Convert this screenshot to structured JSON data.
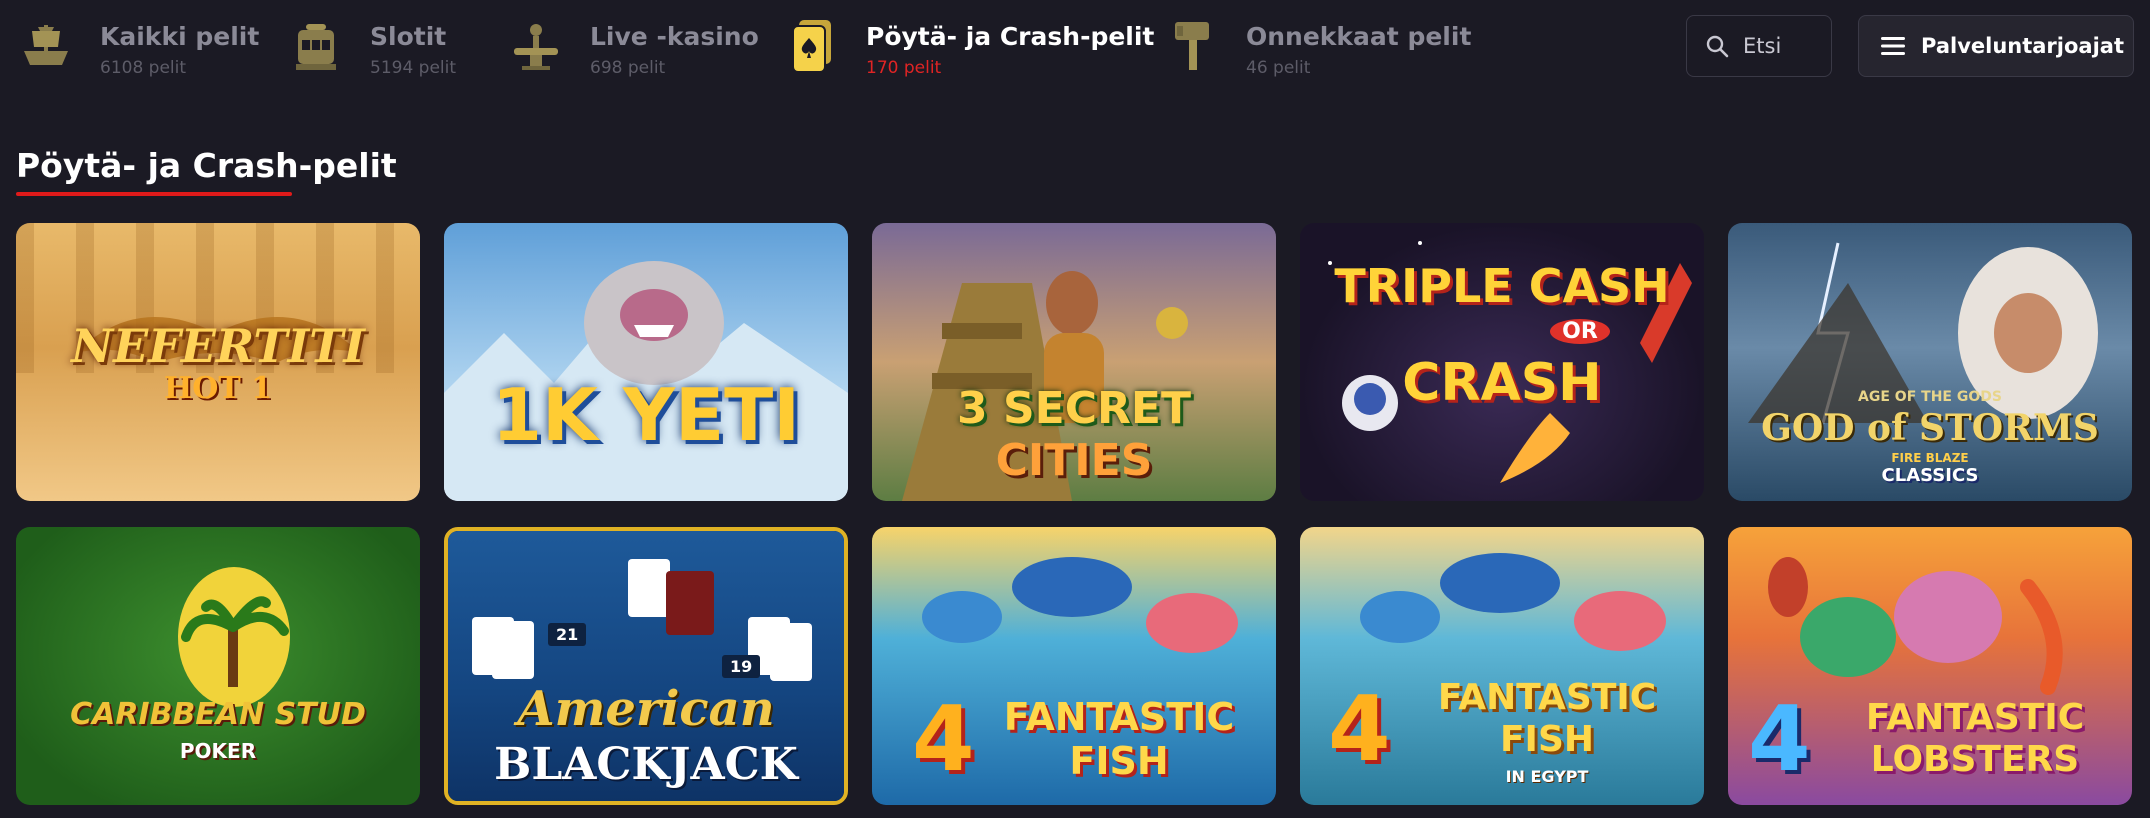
{
  "categories": [
    {
      "name": "Kaikki pelit",
      "count": "6108 pelit",
      "icon": "ship-icon"
    },
    {
      "name": "Slotit",
      "count": "5194 pelit",
      "icon": "slot-machine-icon"
    },
    {
      "name": "Live -kasino",
      "count": "698 pelit",
      "icon": "dealer-table-icon"
    },
    {
      "name": "Pöytä- ja Crash-pelit",
      "count": "170 pelit",
      "icon": "playing-card-icon",
      "active": true
    },
    {
      "name": "Onnekkaat pelit",
      "count": "46 pelit",
      "icon": "hammer-icon"
    }
  ],
  "search": {
    "placeholder": "Etsi"
  },
  "providers": {
    "label": "Palveluntarjoajat"
  },
  "section": {
    "title": "Pöytä- ja Crash-pelit"
  },
  "games": [
    {
      "logo_line1": "NEFERTITI",
      "logo_line2": "HOT 1"
    },
    {
      "logo_line1": "1K YETI",
      "logo_line2": ""
    },
    {
      "logo_line1": "3 SECRET",
      "logo_line2": "CITIES"
    },
    {
      "logo_line1": "TRIPLE CASH",
      "logo_line2": "OR",
      "logo_line3": "CRASH"
    },
    {
      "logo_line1": "AGE OF THE GODS",
      "logo_line2": "GOD of STORMS",
      "logo_line3": "FIRE BLAZE",
      "logo_line4": "CLASSICS"
    },
    {
      "logo_line1": "CARIBBEAN STUD",
      "logo_line2": "POKER"
    },
    {
      "logo_line1": "American",
      "logo_line2": "BLACKJACK",
      "card_left": "21",
      "card_right": "19"
    },
    {
      "logo_line1": "4",
      "logo_line2": "FANTASTIC",
      "logo_line3": "FISH"
    },
    {
      "logo_line1": "4",
      "logo_line2": "FANTASTIC",
      "logo_line3": "FISH",
      "logo_line4": "IN EGYPT"
    },
    {
      "logo_line1": "4",
      "logo_line2": "FANTASTIC",
      "logo_line3": "LOBSTERS"
    }
  ],
  "colors": {
    "accent_red": "#e01a1a",
    "background": "#1b1a24",
    "active_icon": "#f5d24a"
  }
}
